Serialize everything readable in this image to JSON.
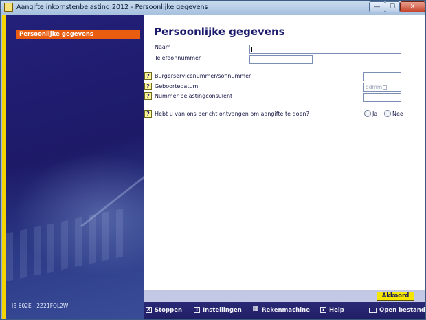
{
  "window": {
    "title": "Aangifte inkomstenbelasting 2012 - Persoonlijke gegevens",
    "controls": {
      "minimize": "—",
      "maximize": "☐",
      "close": "✕"
    }
  },
  "sidebar": {
    "nav_items": [
      {
        "label": "Persoonlijke gegevens",
        "active": true
      }
    ],
    "version": "IB 602E - 2Z21FOL2W"
  },
  "form": {
    "title": "Persoonlijke gegevens",
    "help_glyph": "?",
    "fields": {
      "naam": {
        "label": "Naam",
        "value": ""
      },
      "telefoon": {
        "label": "Telefoonnummer",
        "value": ""
      },
      "bsn": {
        "label": "Burgerservicenummer/sofinummer",
        "value": ""
      },
      "geboortedatum": {
        "label": "Geboortedatum",
        "placeholder": "ddmm"
      },
      "consulent": {
        "label": "Nummer belastingconsulent",
        "value": ""
      }
    },
    "question": {
      "label": "Hebt u van ons bericht ontvangen om aangifte te doen?",
      "options": [
        "Ja",
        "Nee"
      ]
    }
  },
  "footer": {
    "accept": "Akkoord",
    "buttons": [
      {
        "icon": "X",
        "label": "Stoppen"
      },
      {
        "icon": "I",
        "label": "Instellingen"
      },
      {
        "icon": "▦",
        "label": "Rekenmachine"
      },
      {
        "icon": "?",
        "label": "Help"
      },
      {
        "icon": "",
        "label": "Open bestand"
      }
    ]
  },
  "colors": {
    "accent_nav": "#e85d10",
    "sidebar_bg": "#23207a",
    "accept_button": "#f5e600",
    "title_text": "#1b1a6b"
  }
}
